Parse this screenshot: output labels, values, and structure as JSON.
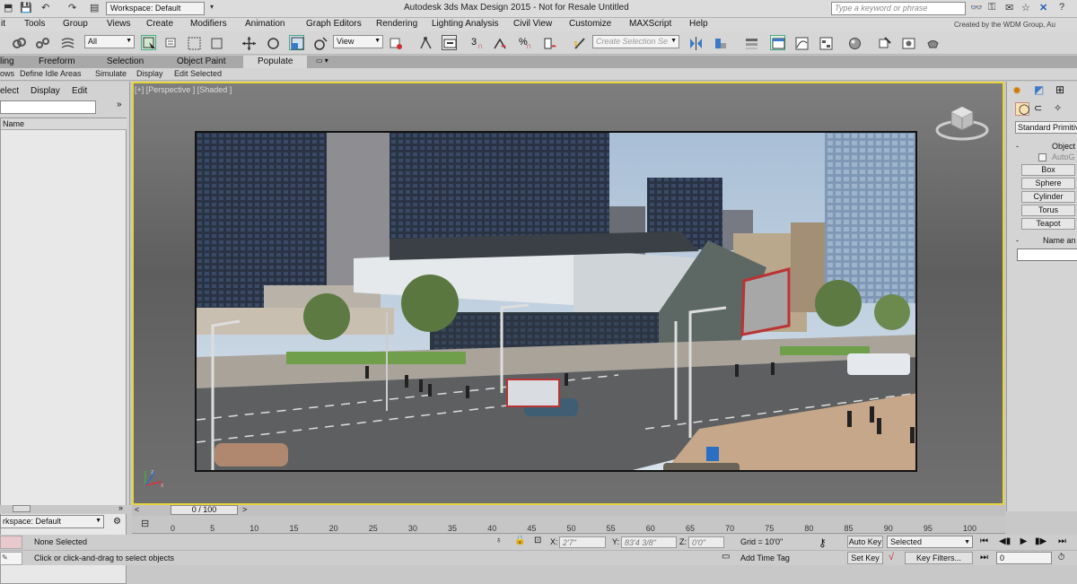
{
  "titlebar": {
    "workspace": "Workspace: Default",
    "title": "Autodesk 3ds Max Design 2015  -  Not for Resale   Untitled",
    "search_placeholder": "Type a keyword or phrase"
  },
  "menu": {
    "items": [
      "it",
      "Tools",
      "Group",
      "Views",
      "Create",
      "Modifiers",
      "Animation",
      "Graph Editors",
      "Rendering",
      "Lighting Analysis",
      "Civil View",
      "Customize",
      "MAXScript",
      "Help"
    ],
    "credit": "Created by the WDM Group, Au"
  },
  "toolbar": {
    "selection_filter": "All",
    "ref_coord": "View",
    "named_selection_placeholder": "Create Selection Se",
    "snap_labels": [
      "3",
      "%"
    ]
  },
  "ribbon": {
    "tabs": [
      "ling",
      "Freeform",
      "Selection",
      "Object Paint",
      "Populate"
    ],
    "subtools": [
      "ows",
      "Define Idle Areas",
      "Simulate",
      "Display",
      "Edit Selected"
    ]
  },
  "scene_explorer": {
    "menu": [
      "elect",
      "Display",
      "Edit"
    ],
    "column_name": "Name",
    "workspace": "rkspace: Default"
  },
  "viewport": {
    "label": "[+] [Perspective ] [Shaded ]"
  },
  "command_panel": {
    "dropdown": "Standard Primitiv",
    "rollout_object_type": "Object",
    "autogrid": "AutoG",
    "buttons": [
      "Box",
      "Sphere",
      "Cylinder",
      "Torus",
      "Teapot"
    ],
    "rollout_name": "Name an"
  },
  "timeline": {
    "frame": "0 / 100",
    "ticks": [
      "0",
      "5",
      "10",
      "15",
      "20",
      "25",
      "30",
      "35",
      "40",
      "45",
      "50",
      "55",
      "60",
      "65",
      "70",
      "75",
      "80",
      "85",
      "90",
      "95",
      "100"
    ]
  },
  "status": {
    "selected": "None Selected",
    "prompt": "Click or click-and-drag to select objects",
    "x_label": "X:",
    "x_value": "2'7\"",
    "y_label": "Y:",
    "y_value": "83'4 3/8\"",
    "z_label": "Z:",
    "z_value": "0'0\"",
    "grid": "Grid = 10'0\"",
    "add_time_tag": "Add Time Tag",
    "auto_key": "Auto Key",
    "set_key": "Set Key",
    "key_mode": "Selected",
    "key_filters": "Key Filters...",
    "frame_field": "0"
  },
  "colors": {
    "viewport_border": "#e8d33c",
    "accent": "#3a7ac8"
  }
}
